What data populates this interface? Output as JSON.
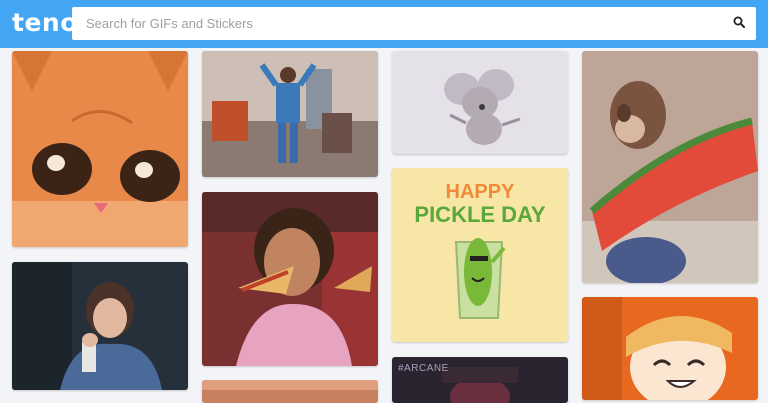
{
  "header": {
    "logo": "tenor",
    "brand_color": "#42a6f5",
    "search": {
      "placeholder": "Search for GIFs and Stickers",
      "value": ""
    },
    "search_icon": "search-icon"
  },
  "grid": {
    "tiles": [
      {
        "subject": "orange cat with big eyes"
      },
      {
        "subject": "man in scrubs dancing in room"
      },
      {
        "subject": "cartoon mouse dancing"
      },
      {
        "subject": "monkey holding watermelon"
      },
      {
        "subject": "woman smiling and talking"
      },
      {
        "subject": "girl eating pizza"
      },
      {
        "subject": "pickle day card",
        "heading_line1": "HAPPY",
        "heading_line2": "PICKLE DAY"
      },
      {
        "subject": "arcane animated character",
        "overlay_text": "#ARCANE"
      },
      {
        "subject": "anime girl in orange hood smiling"
      },
      {
        "subject": "partial tile bottom row"
      }
    ]
  }
}
